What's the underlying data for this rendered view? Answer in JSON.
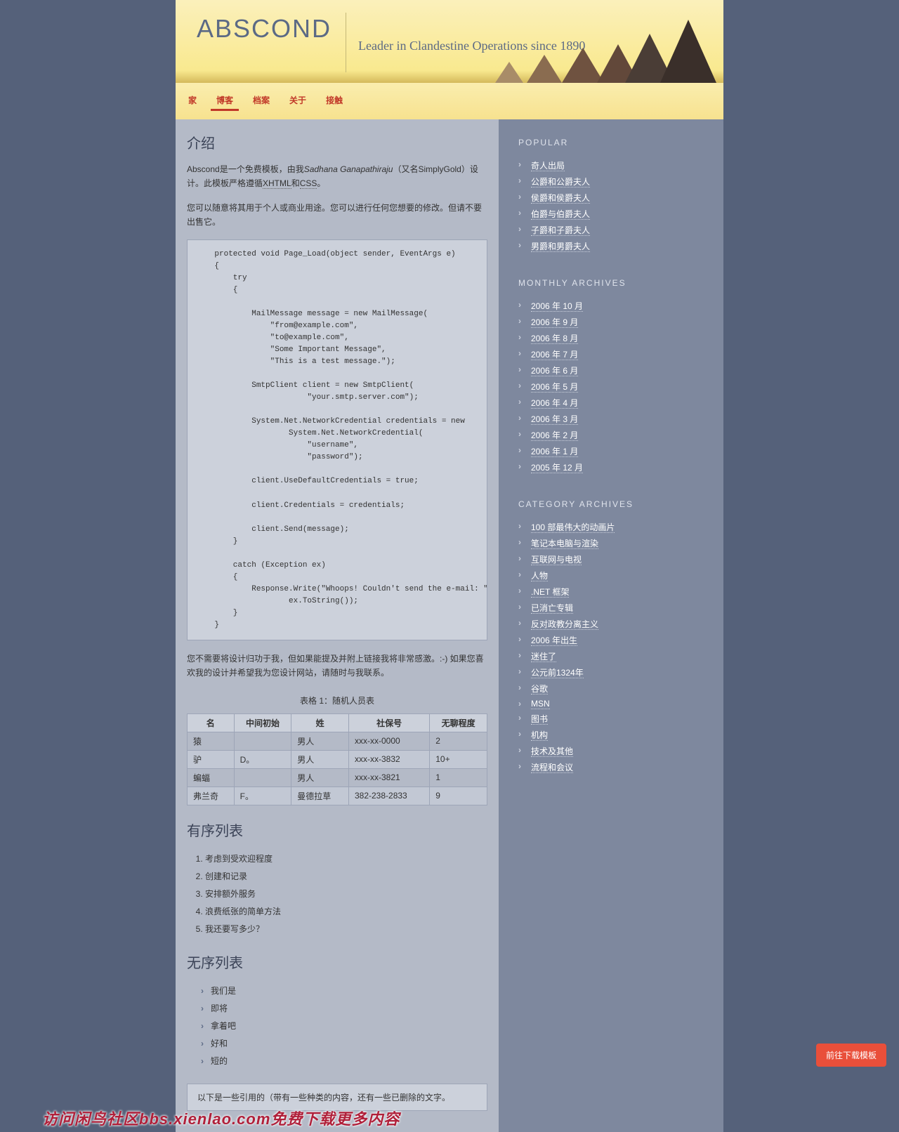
{
  "header": {
    "title": "ABSCOND",
    "tagline": "Leader in Clandestine Operations since 1890"
  },
  "nav": {
    "items": [
      "家",
      "博客",
      "档案",
      "关于",
      "接触"
    ],
    "active": 1
  },
  "main": {
    "intro_heading": "介绍",
    "p1_a": "Abscond是一个免费模板，由我",
    "p1_author": "Sadhana Ganapathiraju",
    "p1_b": "（又名SimplyGold）设计。此模板严格遵循",
    "p1_abbr1": "XHTML",
    "p1_c": "和",
    "p1_abbr2": "CSS",
    "p1_d": "。",
    "p2": "您可以随意将其用于个人或商业用途。您可以进行任何您想要的修改。但请不要出售它。",
    "code": "    protected void Page_Load(object sender, EventArgs e)\n    {\n        try\n        {\n\n            MailMessage message = new MailMessage(\n                \"from@example.com\",\n                \"to@example.com\",\n                \"Some Important Message\",\n                \"This is a test message.\");\n\n            SmtpClient client = new SmtpClient(\n                        \"your.smtp.server.com\");\n\n            System.Net.NetworkCredential credentials = new\n                    System.Net.NetworkCredential(\n                        \"username\",\n                        \"password\");\n\n            client.UseDefaultCredentials = true;\n\n            client.Credentials = credentials;\n\n            client.Send(message);\n        }\n\n        catch (Exception ex)\n        {\n            Response.Write(\"Whoops! Couldn't send the e-mail: \" +\n                    ex.ToString());\n        }\n    }",
    "p3": "您不需要将设计归功于我，但如果能提及并附上链接我将非常感激。:-) 如果您喜欢我的设计并希望我为您设计网站，请随时与我联系。",
    "table": {
      "caption": "表格 1：随机人员表",
      "headers": [
        "名",
        "中间初始",
        "姓",
        "社保号",
        "无聊程度"
      ],
      "rows": [
        [
          "猿",
          "",
          "男人",
          "xxx-xx-0000",
          "2"
        ],
        [
          "驴",
          "D。",
          "男人",
          "xxx-xx-3832",
          "10+"
        ],
        [
          "蝙蝠",
          "",
          "男人",
          "xxx-xx-3821",
          "1"
        ],
        [
          "弗兰奇",
          "F。",
          "曼德拉草",
          "382-238-2833",
          "9"
        ]
      ]
    },
    "ol_heading": "有序列表",
    "ol_items": [
      "考虑到受欢迎程度",
      "创建和记录",
      "安排额外服务",
      "浪费纸张的简单方法",
      "我还要写多少？"
    ],
    "ul_heading": "无序列表",
    "ul_items": [
      "我们是",
      "即将",
      "拿着吧",
      "好和",
      "短的"
    ],
    "bq": "以下是一些引用的（带有一些种类的内容，还有一些已删除的文字。"
  },
  "sidebar": {
    "popular": {
      "title": "POPULAR",
      "items": [
        "奇人出局",
        "公爵和公爵夫人",
        "侯爵和侯爵夫人",
        "伯爵与伯爵夫人",
        "子爵和子爵夫人",
        "男爵和男爵夫人"
      ]
    },
    "monthly": {
      "title": "MONTHLY ARCHIVES",
      "items": [
        "2006 年 10 月",
        "2006 年 9 月",
        "2006 年 8 月",
        "2006 年 7 月",
        "2006 年 6 月",
        "2006 年 5 月",
        "2006 年 4 月",
        "2006 年 3 月",
        "2006 年 2 月",
        "2006 年 1 月",
        "2005 年 12 月"
      ]
    },
    "category": {
      "title": "CATEGORY ARCHIVES",
      "items": [
        "100 部最伟大的动画片",
        "笔记本电脑与渲染",
        "互联网与电视",
        "人物",
        ".NET 框架",
        "已消亡专辑",
        "反对政教分离主义",
        "2006 年出生",
        "迷住了",
        "公元前1324年",
        "谷歌",
        "MSN",
        "图书",
        "机构",
        "技术及其他",
        "流程和会议"
      ]
    }
  },
  "download_btn": "前往下载模板",
  "watermark": "访问闲鸟社区bbs.xienlao.com免费下载更多内容"
}
